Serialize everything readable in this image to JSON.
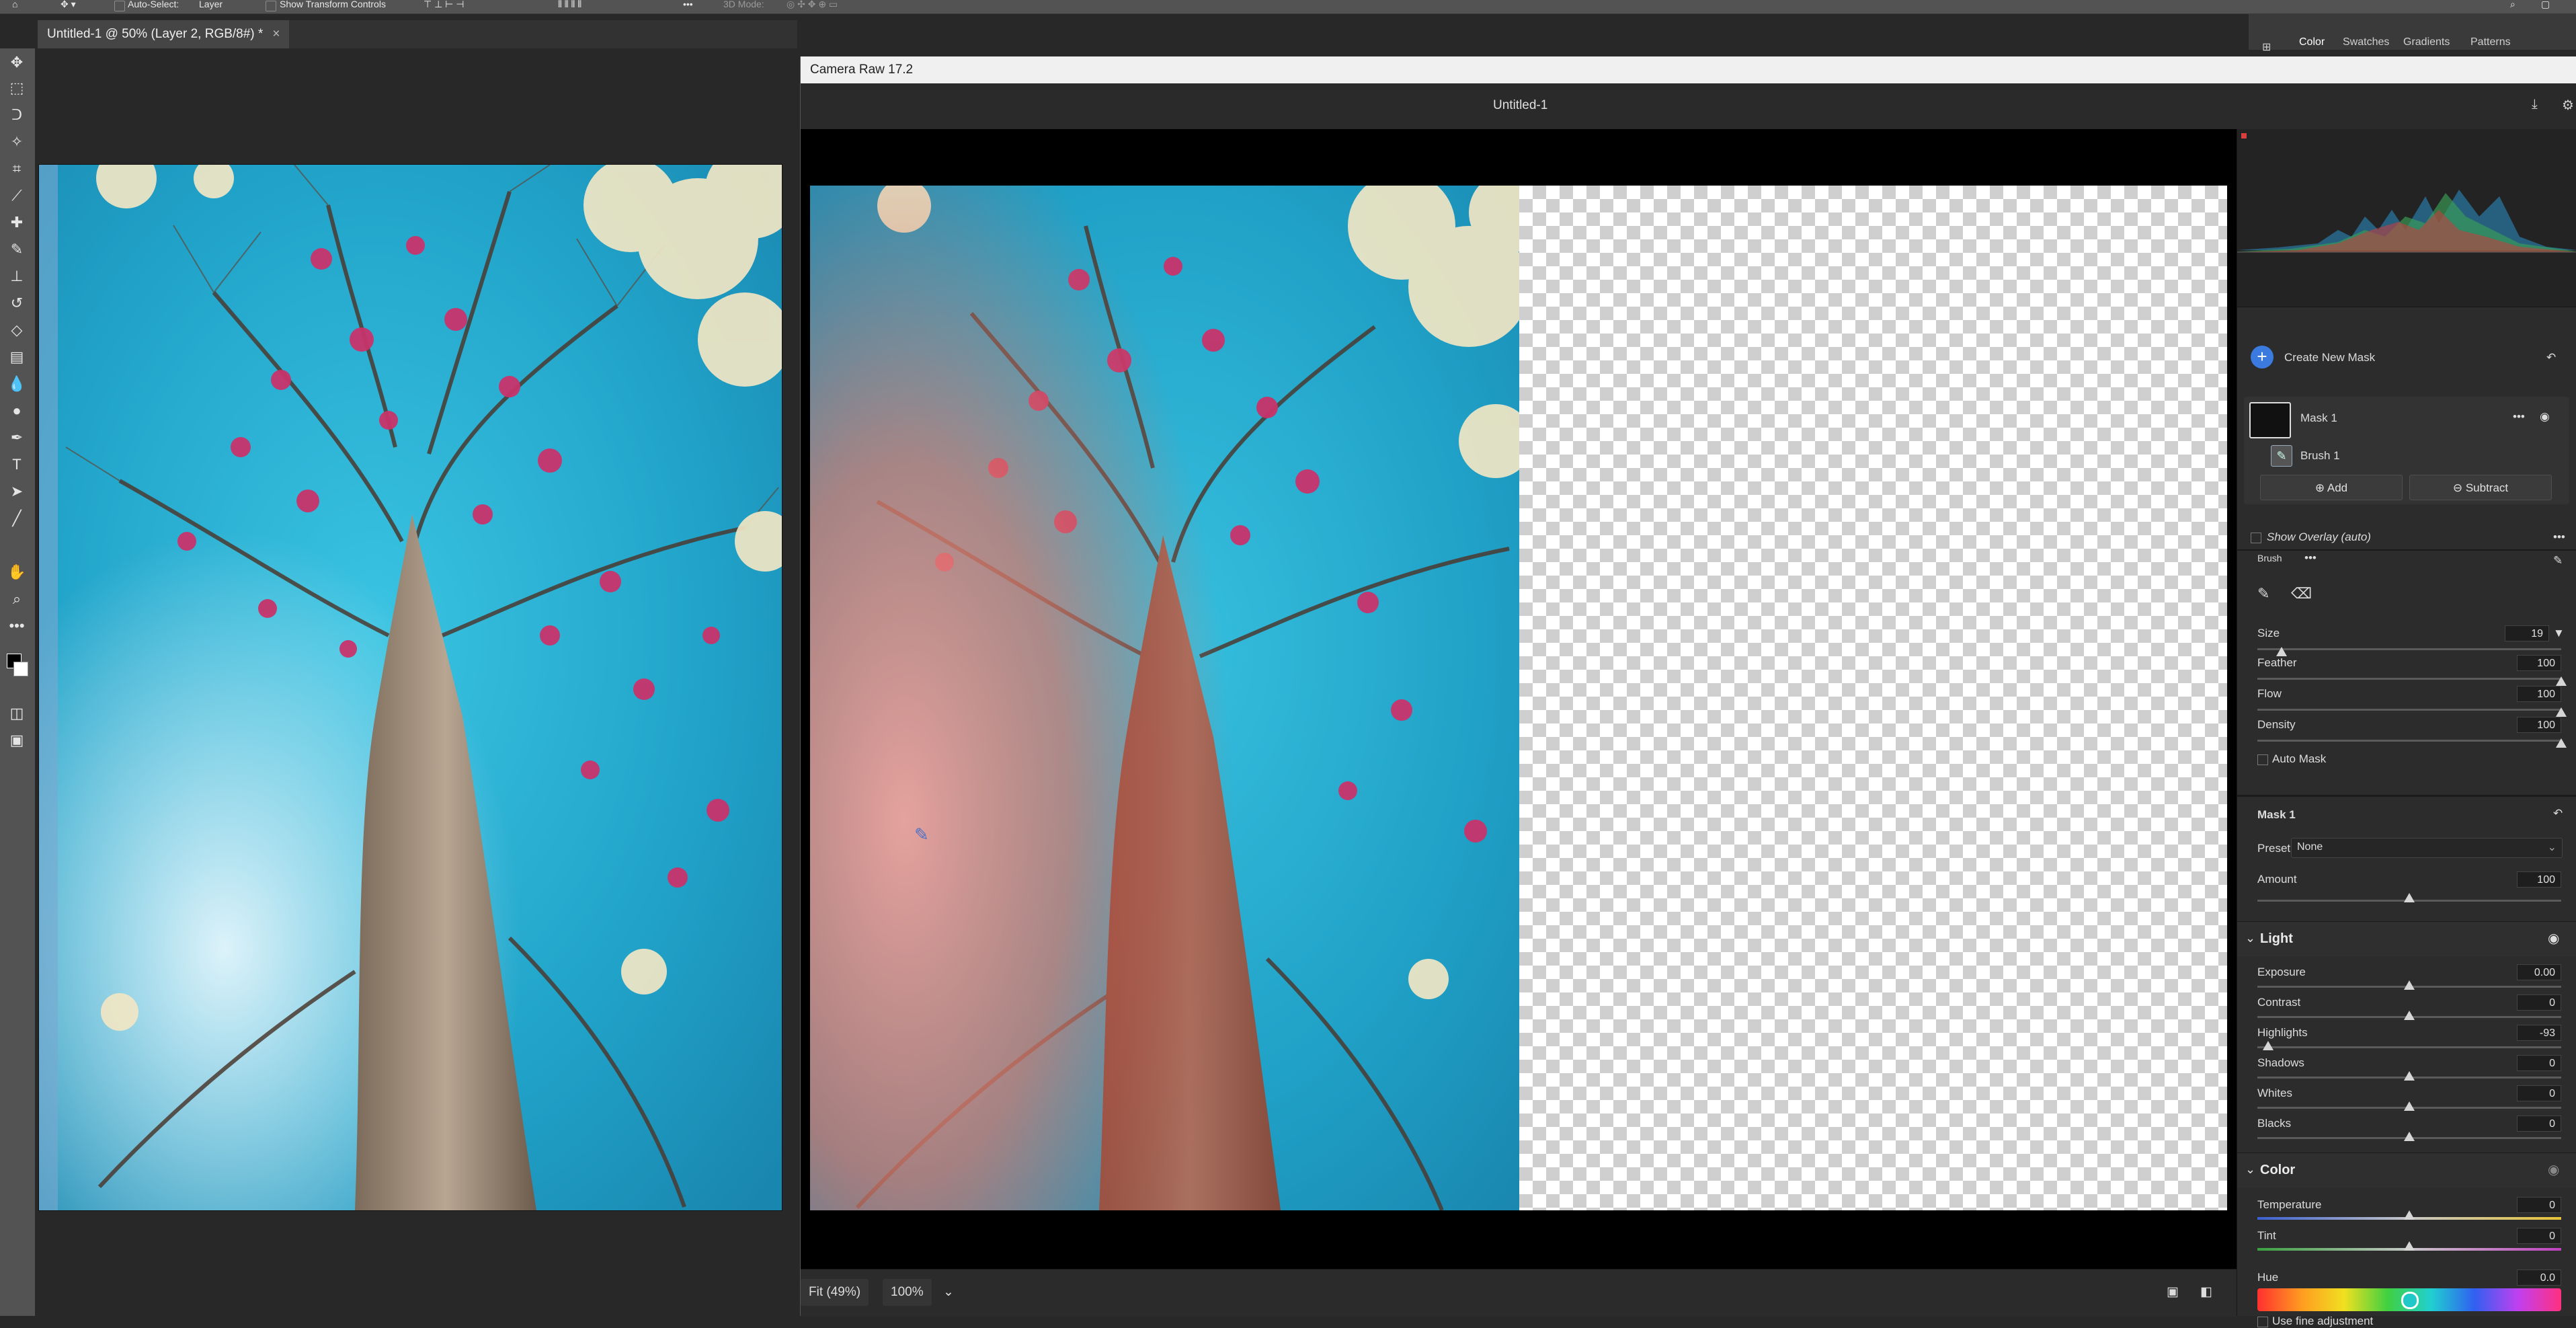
{
  "options_bar": {
    "auto_select_label": "Auto-Select:",
    "auto_select_value": "Layer",
    "show_transform_label": "Show Transform Controls",
    "mode_label": "3D Mode:"
  },
  "document": {
    "tab_title": "Untitled-1 @ 50% (Layer 2, RGB/8#) *",
    "close": "×"
  },
  "tools": [
    "move-tool",
    "marquee-tool",
    "lasso-tool",
    "magic-wand-tool",
    "crop-tool",
    "eyedropper-tool",
    "healing-tool",
    "brush-tool",
    "stamp-tool",
    "history-brush-tool",
    "eraser-tool",
    "gradient-tool",
    "blur-tool",
    "dodge-tool",
    "pen-tool",
    "type-tool",
    "path-select-tool",
    "line-tool",
    "hand-tool",
    "zoom-tool",
    "more-tools"
  ],
  "ps_panels": {
    "tabs": [
      "Color",
      "Swatches",
      "Gradients",
      "Patterns"
    ]
  },
  "camera_raw": {
    "title": "Camera Raw 17.2",
    "document_name": "Untitled-1",
    "footer": {
      "fit_label": "Fit (49%)",
      "zoom_label": "100%"
    },
    "masks": {
      "create_new_mask": "Create New Mask",
      "mask_name": "Mask 1",
      "brush_name": "Brush 1",
      "add_label": "Add",
      "subtract_label": "Subtract",
      "show_overlay": "Show Overlay (auto)"
    },
    "brush": {
      "title": "Brush",
      "size_label": "Size",
      "size_value": "19",
      "size_level": 0.08,
      "feather_label": "Feather",
      "feather_value": "100",
      "feather_level": 1,
      "flow_label": "Flow",
      "flow_value": "100",
      "flow_level": 1,
      "density_label": "Density",
      "density_value": "100",
      "density_level": 1,
      "auto_mask_label": "Auto Mask"
    },
    "mask_settings": {
      "title": "Mask 1",
      "preset_label": "Preset",
      "preset_value": "None",
      "amount_label": "Amount",
      "amount_value": "100",
      "amount_level": 0.5
    },
    "light": {
      "title": "Light",
      "sliders": [
        {
          "label": "Exposure",
          "value": "0.00",
          "level": 0.5
        },
        {
          "label": "Contrast",
          "value": "0",
          "level": 0.5
        },
        {
          "label": "Highlights",
          "value": "-93",
          "level": 0.035
        },
        {
          "label": "Shadows",
          "value": "0",
          "level": 0.5
        },
        {
          "label": "Whites",
          "value": "0",
          "level": 0.5
        },
        {
          "label": "Blacks",
          "value": "0",
          "level": 0.5
        }
      ]
    },
    "color": {
      "title": "Color",
      "temperature_label": "Temperature",
      "temperature_value": "0",
      "tint_label": "Tint",
      "tint_value": "0",
      "hue_label": "Hue",
      "hue_value": "0.0",
      "fine_adjust_label": "Use fine adjustment"
    }
  }
}
